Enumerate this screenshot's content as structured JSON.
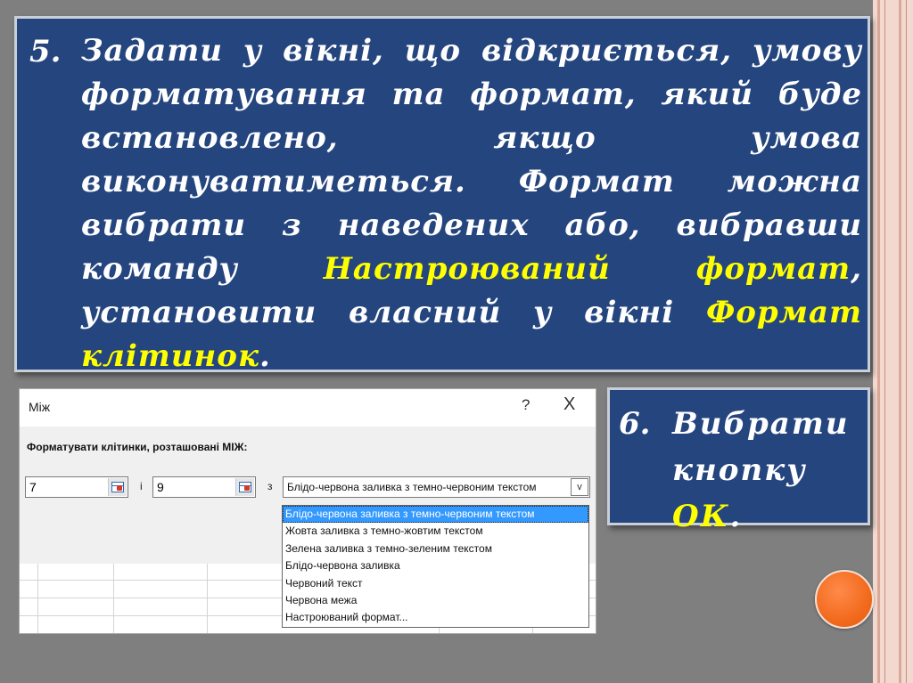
{
  "slide": {
    "step5": {
      "number": "5.",
      "text_before": "Задати у вікні, що відкриється, умову форматування та формат, який буде встановлено, якщо умова виконуватиметься. Формат можна вибрати з наведених або, вибравши команду ",
      "highlight1": "Настроюваний формат",
      "text_middle": ", установити власний у вікні ",
      "highlight2": "Формат клітинок",
      "text_end": "."
    },
    "step6": {
      "number": "6.",
      "text_before": "Вибрати кнопку ",
      "highlight": "ОК",
      "text_end": "."
    }
  },
  "dialog": {
    "title": "Між",
    "help_icon": "?",
    "close_icon": "X",
    "label": "Форматувати клітинки, розташовані МІЖ:",
    "value_from": "7",
    "conj_and": "і",
    "value_to": "9",
    "conj_with": "з",
    "format_select": "Блідо-червона заливка з темно-червоним текстом",
    "dropdown_arrow": "v"
  },
  "dropdown": {
    "items": [
      "Блідо-червона заливка з темно-червоним текстом",
      "Жовта заливка з темно-жовтим текстом",
      "Зелена заливка з темно-зеленим текстом",
      "Блідо-червона заливка",
      "Червоний текст",
      "Червона межа",
      "Настроюваний формат..."
    ],
    "selected_index": 0
  },
  "colors": {
    "background": "#7f7f7f",
    "panel": "#25457e",
    "highlight_text": "#ffff00",
    "accent_circle": "#f26b1d",
    "selected_item": "#3399ff"
  }
}
